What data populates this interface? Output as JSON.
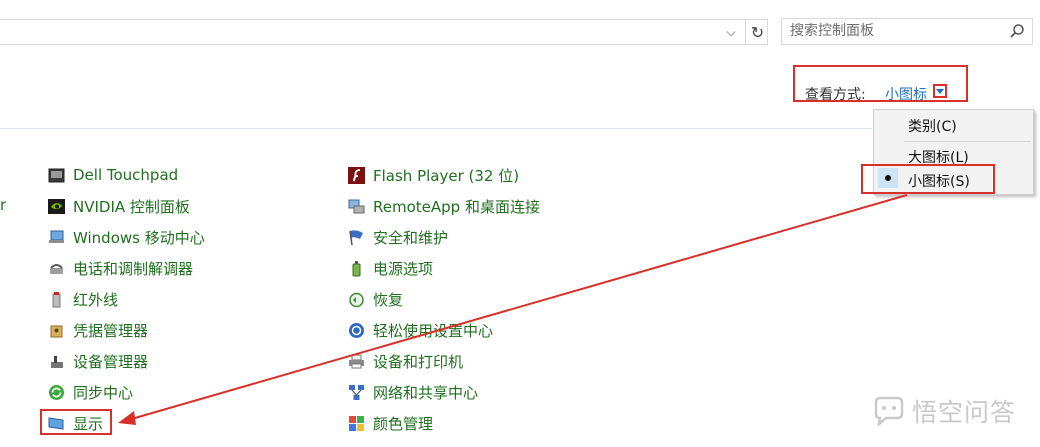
{
  "address_bar": {
    "refresh_glyph": "↻",
    "dropdown_glyph": "⌵"
  },
  "search": {
    "placeholder": "搜索控制面板",
    "icon": "search-icon"
  },
  "view_mode": {
    "label": "查看方式:",
    "value": "小图标"
  },
  "view_menu": {
    "items": [
      {
        "label": "类别(C)",
        "selected": false
      },
      {
        "label": "大图标(L)",
        "selected": false
      },
      {
        "label": "小图标(S)",
        "selected": true
      }
    ]
  },
  "left_edge_text": "r",
  "columns": [
    {
      "items": [
        {
          "label": "Dell Touchpad",
          "icon": "touchpad-icon"
        },
        {
          "label": "NVIDIA 控制面板",
          "icon": "nvidia-icon"
        },
        {
          "label": "Windows 移动中心",
          "icon": "mobility-center-icon"
        },
        {
          "label": "电话和调制解调器",
          "icon": "phone-modem-icon"
        },
        {
          "label": "红外线",
          "icon": "infrared-icon"
        },
        {
          "label": "凭据管理器",
          "icon": "credential-manager-icon"
        },
        {
          "label": "设备管理器",
          "icon": "device-manager-icon"
        },
        {
          "label": "同步中心",
          "icon": "sync-center-icon"
        },
        {
          "label": "显示",
          "icon": "display-icon"
        }
      ]
    },
    {
      "items": [
        {
          "label": "Flash Player (32 位)",
          "icon": "flash-player-icon"
        },
        {
          "label": "RemoteApp 和桌面连接",
          "icon": "remoteapp-icon"
        },
        {
          "label": "安全和维护",
          "icon": "security-flag-icon"
        },
        {
          "label": "电源选项",
          "icon": "power-options-icon"
        },
        {
          "label": "恢复",
          "icon": "recovery-icon"
        },
        {
          "label": "轻松使用设置中心",
          "icon": "ease-of-access-icon"
        },
        {
          "label": "设备和打印机",
          "icon": "printer-icon"
        },
        {
          "label": "网络和共享中心",
          "icon": "network-icon"
        },
        {
          "label": "颜色管理",
          "icon": "color-management-icon"
        }
      ]
    }
  ],
  "watermark": {
    "text": "悟空问答",
    "icon": "wukong-logo-icon"
  },
  "colors": {
    "link_green": "#1f6f1f",
    "annotation_red": "#d9302b",
    "view_blue": "#1e6fc2"
  }
}
